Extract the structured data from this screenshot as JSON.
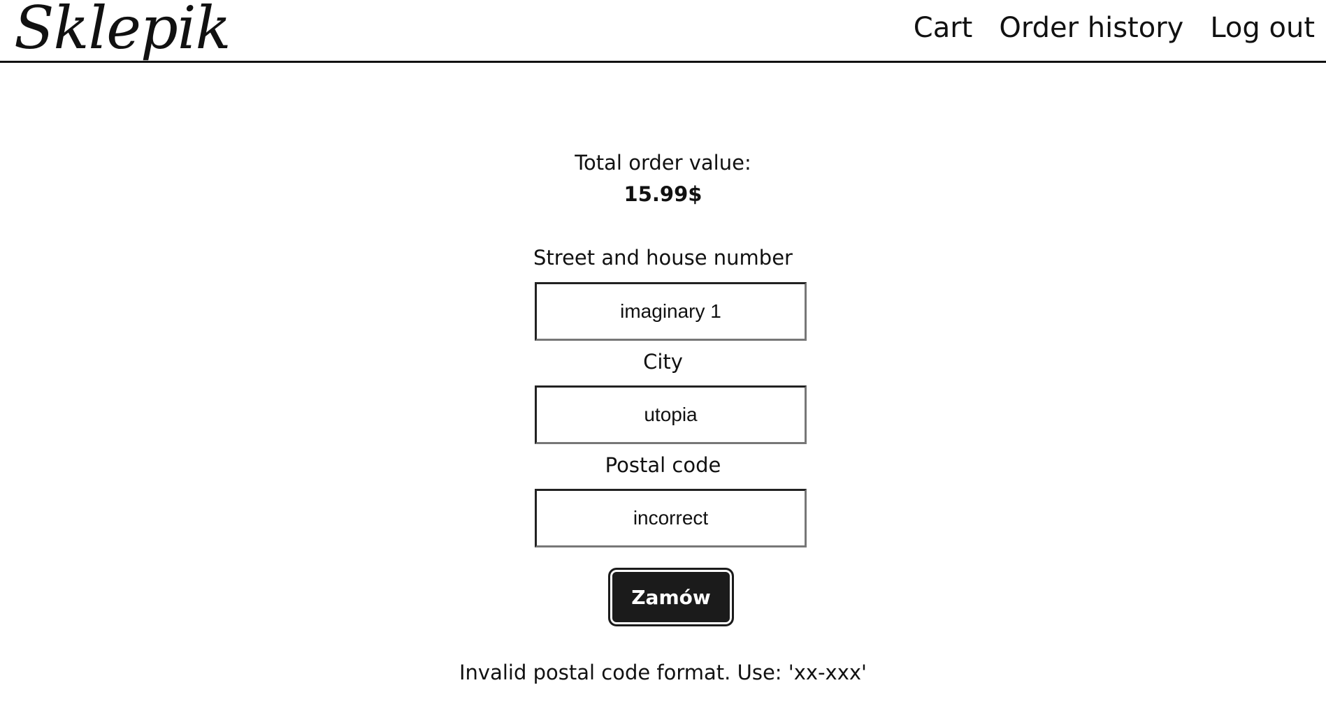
{
  "header": {
    "logo": "Sklepik",
    "nav": {
      "cart": "Cart",
      "order_history": "Order history",
      "log_out": "Log out"
    }
  },
  "order": {
    "total_label": "Total order value:",
    "total_value": "15.99$"
  },
  "form": {
    "street": {
      "label": "Street and house number",
      "value": "imaginary 1"
    },
    "city": {
      "label": "City",
      "value": "utopia"
    },
    "postal": {
      "label": "Postal code",
      "value": "incorrect"
    },
    "submit_label": "Zamów",
    "error": "Invalid postal code format. Use: 'xx-xxx'"
  }
}
